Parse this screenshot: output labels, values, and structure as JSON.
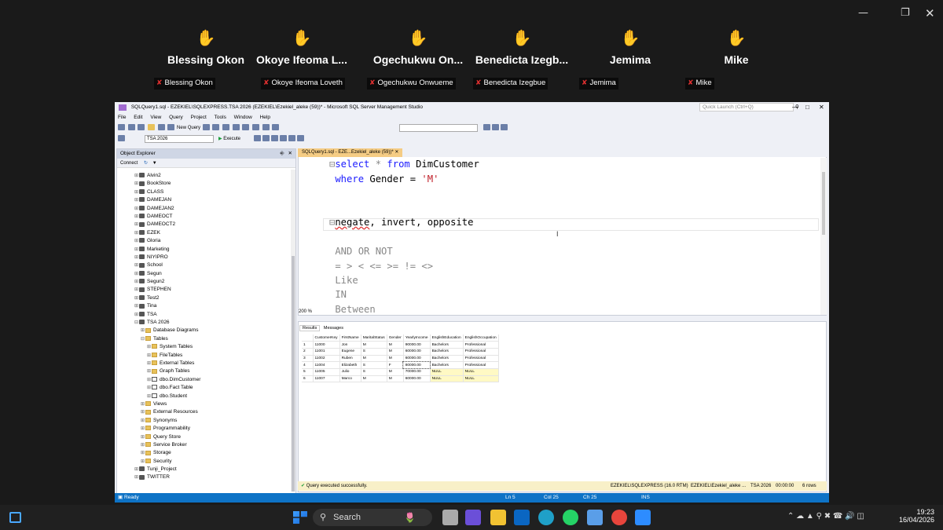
{
  "participants": [
    {
      "name": "Blessing Okon",
      "label": "Blessing Okon",
      "hand": "✋"
    },
    {
      "name": "Okoye Ifeoma L...",
      "label": "Okoye Ifeoma Loveth",
      "hand": "✋"
    },
    {
      "name": "Ogechukwu On...",
      "label": "Ogechukwu Onwueme",
      "hand": "✋"
    },
    {
      "name": "Benedicta Izegb...",
      "label": "Benedicta Izegbue",
      "hand": "✋"
    },
    {
      "name": "Jemima",
      "label": "Jemima",
      "hand": "✋"
    },
    {
      "name": "Mike",
      "label": "Mike",
      "hand": "✋"
    }
  ],
  "window": {
    "title": "SQLQuery1.sql - EZEKIEL\\SQLEXPRESS.TSA 2026 (EZEKIEL\\Ezekiel_aleke (59))* - Microsoft SQL Server Management Studio",
    "quick_launch": "Quick Launch (Ctrl+Q)",
    "menu": [
      "File",
      "Edit",
      "View",
      "Query",
      "Project",
      "Tools",
      "Window",
      "Help"
    ],
    "new_query": "New Query",
    "db_select": "TSA 2026",
    "execute": "Execute"
  },
  "object_explorer": {
    "title": "Object Explorer",
    "connect": "Connect",
    "items": [
      {
        "label": "Alvin2",
        "type": "db",
        "level": 0
      },
      {
        "label": "BookStore",
        "type": "db",
        "level": 0
      },
      {
        "label": "CLASS",
        "type": "db",
        "level": 0
      },
      {
        "label": "DAMEJAN",
        "type": "db",
        "level": 0
      },
      {
        "label": "DAMEJAN2",
        "type": "db",
        "level": 0
      },
      {
        "label": "DAMEOCT",
        "type": "db",
        "level": 0
      },
      {
        "label": "DAMEOCT2",
        "type": "db",
        "level": 0
      },
      {
        "label": "EZEK",
        "type": "db",
        "level": 0
      },
      {
        "label": "Gloria",
        "type": "db",
        "level": 0
      },
      {
        "label": "Marketing",
        "type": "db",
        "level": 0
      },
      {
        "label": "NIYIPRO",
        "type": "db",
        "level": 0
      },
      {
        "label": "School",
        "type": "db",
        "level": 0
      },
      {
        "label": "Segun",
        "type": "db",
        "level": 0
      },
      {
        "label": "Segun2",
        "type": "db",
        "level": 0
      },
      {
        "label": "STEPHEN",
        "type": "db",
        "level": 0
      },
      {
        "label": "Test2",
        "type": "db",
        "level": 0
      },
      {
        "label": "Tina",
        "type": "db",
        "level": 0
      },
      {
        "label": "TSA",
        "type": "db",
        "level": 0
      },
      {
        "label": "TSA 2026",
        "type": "db",
        "level": 0
      },
      {
        "label": "Database Diagrams",
        "type": "folder",
        "level": 1
      },
      {
        "label": "Tables",
        "type": "folder",
        "level": 1
      },
      {
        "label": "System Tables",
        "type": "folder",
        "level": 2
      },
      {
        "label": "FileTables",
        "type": "folder",
        "level": 2
      },
      {
        "label": "External Tables",
        "type": "folder",
        "level": 2
      },
      {
        "label": "Graph Tables",
        "type": "folder",
        "level": 2
      },
      {
        "label": "dbo.DimCustomer",
        "type": "table",
        "level": 2
      },
      {
        "label": "dbo.Fact Table",
        "type": "table",
        "level": 2
      },
      {
        "label": "dbo.Student",
        "type": "table",
        "level": 2
      },
      {
        "label": "Views",
        "type": "folder",
        "level": 1
      },
      {
        "label": "External Resources",
        "type": "folder",
        "level": 1
      },
      {
        "label": "Synonyms",
        "type": "folder",
        "level": 1
      },
      {
        "label": "Programmability",
        "type": "folder",
        "level": 1
      },
      {
        "label": "Query Store",
        "type": "folder",
        "level": 1
      },
      {
        "label": "Service Broker",
        "type": "folder",
        "level": 1
      },
      {
        "label": "Storage",
        "type": "folder",
        "level": 1
      },
      {
        "label": "Security",
        "type": "folder",
        "level": 1
      },
      {
        "label": "Tunji_Project",
        "type": "db",
        "level": 0
      },
      {
        "label": "TWITTER",
        "type": "db",
        "level": 0
      }
    ]
  },
  "editor": {
    "tab": "SQLQuery1.sql - EZE...Ezekiel_aleke (59))*",
    "zoom": "200 %",
    "line1_kw1": "select",
    "line1_rest": " * ",
    "line1_kw2": "from",
    "line1_obj": " DimCustomer",
    "line2_kw": "where",
    "line2_mid": " Gender = ",
    "line2_str": "'M'",
    "line3_a": "negate",
    "line3_b": ", invert, opposite",
    "line4": "AND OR NOT",
    "line5": "= > < <= >= != <>",
    "line6": "Like",
    "line7": "IN",
    "line8": "Between"
  },
  "results": {
    "tab_results": "Results",
    "tab_messages": "Messages",
    "columns": [
      "CustomerKey",
      "FirstName",
      "MaritalStatus",
      "Gender",
      "YearlyIncome",
      "EnglishEducation",
      "EnglishOccupation"
    ],
    "rows": [
      [
        "1",
        "11000",
        "Jon",
        "M",
        "M",
        "90000.00",
        "Bachelors",
        "Professional"
      ],
      [
        "2",
        "11001",
        "Eugene",
        "S",
        "M",
        "60000.00",
        "Bachelors",
        "Professional"
      ],
      [
        "3",
        "11002",
        "Ruben",
        "M",
        "M",
        "60000.00",
        "Bachelors",
        "Professional"
      ],
      [
        "4",
        "11004",
        "Elizabeth",
        "S",
        "F",
        "80000.00",
        "Bachelors",
        "Professional"
      ],
      [
        "5",
        "11005",
        "Julio",
        "S",
        "M",
        "70000.00",
        "NULL",
        "NULL"
      ],
      [
        "6",
        "11007",
        "Marco",
        "M",
        "M",
        "60000.00",
        "NULL",
        "NULL"
      ]
    ],
    "status": "Query executed successfully.",
    "server": "EZEKIEL\\SQLEXPRESS (16.0 RTM)",
    "user": "EZEKIEL\\Ezekiel_aleke ...",
    "db": "TSA 2026",
    "time": "00:00:00",
    "rowcount": "6 rows"
  },
  "statusbar": {
    "ready": "Ready",
    "ln": "Ln 5",
    "col": "Col 25",
    "ch": "Ch 25",
    "ins": "INS"
  },
  "taskbar": {
    "search": "Search",
    "time": "19:23",
    "date": "16/04/2026"
  },
  "colors": {
    "hand_default": "#f4c542",
    "hand_brown": "#8d5a3b",
    "ssms_status": "#0e73c6",
    "keyword": "#1a1aff",
    "string": "#c0202a"
  }
}
